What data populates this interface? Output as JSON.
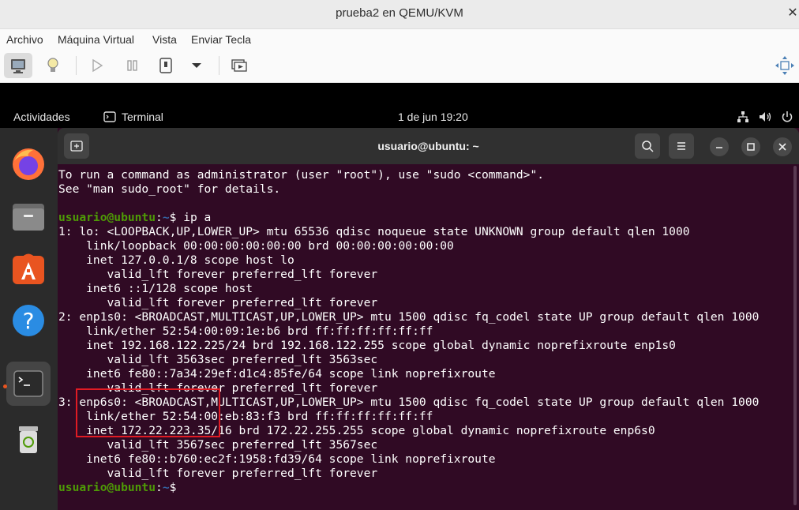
{
  "window": {
    "title": "prueba2 en QEMU/KVM",
    "close_glyph": "✕"
  },
  "menu": [
    "Archivo",
    "Máquina Virtual",
    "Vista",
    "Enviar Tecla"
  ],
  "toolbar": {
    "icons": [
      "monitor-icon",
      "lightbulb-icon",
      "play-icon",
      "pause-icon",
      "power-icon",
      "dropdown-arrow-icon",
      "snapshots-icon",
      "fullscreen-icon"
    ]
  },
  "guest": {
    "topbar": {
      "activities": "Actividades",
      "app_name": "Terminal",
      "clock": "1 de jun  19:20"
    },
    "dock": {
      "apps": [
        "firefox-icon",
        "files-icon",
        "app-center-icon",
        "help-icon",
        "terminal-icon",
        "trash-icon"
      ]
    },
    "terminal": {
      "title": "usuario@ubuntu: ~",
      "prompt_user": "usuario@ubuntu",
      "prompt_path": "~",
      "prompt_sign": "$",
      "command": " ip a",
      "lines": [
        "To run a command as administrator (user \"root\"), use \"sudo <command>\".",
        "See \"man sudo_root\" for details.",
        "",
        "__PROMPT__",
        "1: lo: <LOOPBACK,UP,LOWER_UP> mtu 65536 qdisc noqueue state UNKNOWN group default qlen 1000",
        "    link/loopback 00:00:00:00:00:00 brd 00:00:00:00:00:00",
        "    inet 127.0.0.1/8 scope host lo",
        "       valid_lft forever preferred_lft forever",
        "    inet6 ::1/128 scope host",
        "       valid_lft forever preferred_lft forever",
        "2: enp1s0: <BROADCAST,MULTICAST,UP,LOWER_UP> mtu 1500 qdisc fq_codel state UP group default qlen 1000",
        "    link/ether 52:54:00:09:1e:b6 brd ff:ff:ff:ff:ff:ff",
        "    inet 192.168.122.225/24 brd 192.168.122.255 scope global dynamic noprefixroute enp1s0",
        "       valid_lft 3563sec preferred_lft 3563sec",
        "    inet6 fe80::7a34:29ef:d1c4:85fe/64 scope link noprefixroute",
        "       valid_lft forever preferred_lft forever",
        "3: enp6s0: <BROADCAST,MULTICAST,UP,LOWER_UP> mtu 1500 qdisc fq_codel state UP group default qlen 1000",
        "    link/ether 52:54:00:eb:83:f3 brd ff:ff:ff:ff:ff:ff",
        "    inet 172.22.223.35/16 brd 172.22.255.255 scope global dynamic noprefixroute enp6s0",
        "       valid_lft 3567sec preferred_lft 3567sec",
        "    inet6 fe80::b760:ec2f:1958:fd39/64 scope link noprefixroute",
        "       valid_lft forever preferred_lft forever",
        "__PROMPT_EMPTY__"
      ]
    }
  },
  "colors": {
    "terminal_bg": "#300a24",
    "prompt_user": "#4e9a06",
    "prompt_path": "#3465a4",
    "highlight_box": "#e01b24"
  }
}
